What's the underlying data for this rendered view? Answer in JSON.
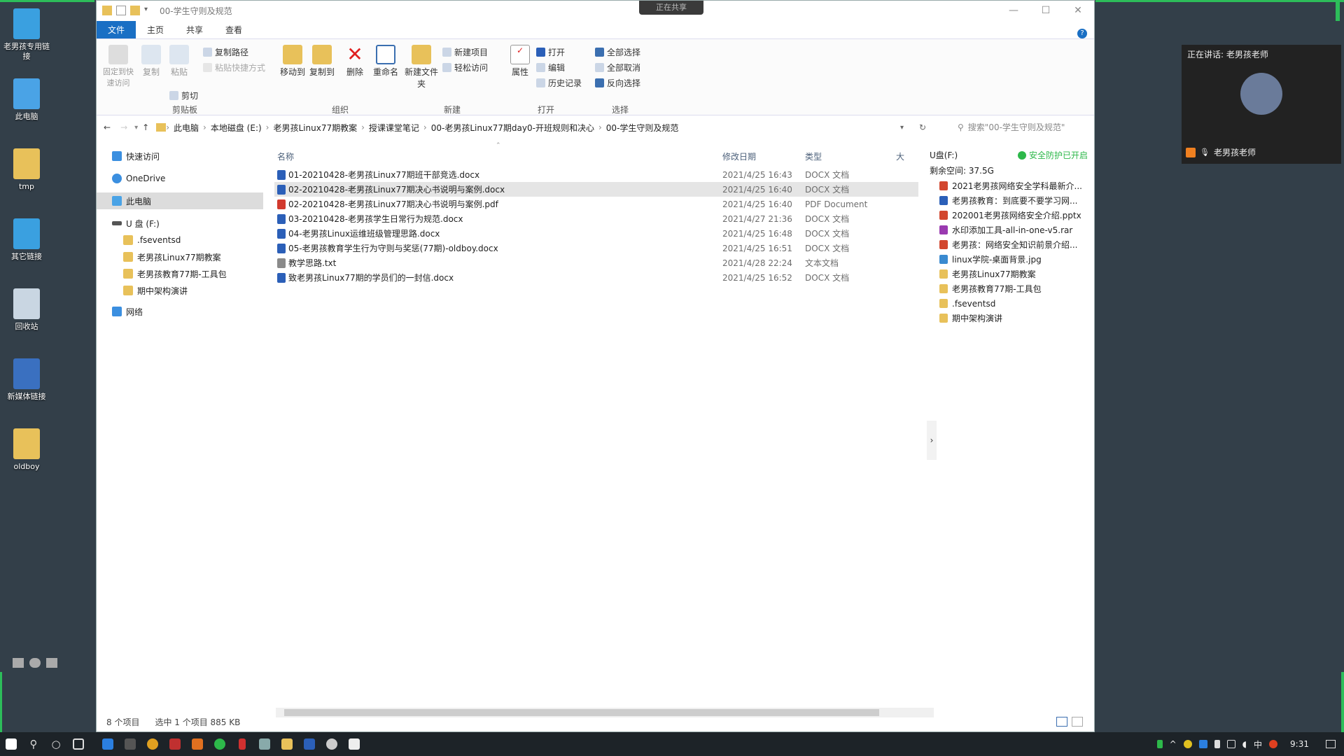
{
  "desktop": {
    "icons": [
      {
        "label": "老男孩专用链接",
        "color": "#3aa0e0"
      },
      {
        "label": "此电脑",
        "color": "#4aa3e6"
      },
      {
        "label": "tmp",
        "color": "#e8c15a"
      },
      {
        "label": "其它链接",
        "color": "#3aa0e0"
      },
      {
        "label": "回收站",
        "color": "#c9d6e2"
      },
      {
        "label": "新媒体链接",
        "color": "#3a70c0"
      },
      {
        "label": "oldboy",
        "color": "#e8c15a"
      }
    ]
  },
  "window": {
    "title": "00-学生守则及规范",
    "share_banner": "正在共享",
    "ribbon_tabs": [
      "文件",
      "主页",
      "共享",
      "查看"
    ],
    "ribbon": {
      "pin": "固定到快速访问",
      "copy": "复制",
      "paste": "粘贴",
      "copy_path": "复制路径",
      "paste_shortcut": "粘贴快捷方式",
      "cut": "剪切",
      "move_to": "移动到",
      "copy_to": "复制到",
      "delete": "删除",
      "rename": "重命名",
      "new_folder": "新建文件夹",
      "new_item": "新建项目",
      "easy_access": "轻松访问",
      "properties": "属性",
      "open": "打开",
      "edit": "编辑",
      "history": "历史记录",
      "select_all": "全部选择",
      "select_none": "全部取消",
      "invert": "反向选择",
      "groups": [
        "剪贴板",
        "组织",
        "新建",
        "打开",
        "选择"
      ]
    },
    "address": {
      "crumbs": [
        "此电脑",
        "本地磁盘 (E:)",
        "老男孩Linux77期教案",
        "授课课堂笔记",
        "00-老男孩Linux77期day0-开班规则和决心",
        "00-学生守则及规范"
      ],
      "search_placeholder": "搜索\"00-学生守则及规范\""
    },
    "nav": {
      "quick_access": "快速访问",
      "onedrive": "OneDrive",
      "this_pc": "此电脑",
      "usb": "U 盘 (F:)",
      "usb_children": [
        ".fseventsd",
        "老男孩Linux77期教案",
        "老男孩教育77期-工具包",
        "期中架构演讲"
      ],
      "network": "网络"
    },
    "columns": {
      "name": "名称",
      "date": "修改日期",
      "type": "类型",
      "size": "大"
    },
    "files": [
      {
        "name": "01-20210428-老男孩Linux77期班干部竞选.docx",
        "date": "2021/4/25 16:43",
        "type": "DOCX 文档",
        "color": "#2b5fb8"
      },
      {
        "name": "02-20210428-老男孩Linux77期决心书说明与案例.docx",
        "date": "2021/4/25 16:40",
        "type": "DOCX 文档",
        "color": "#2b5fb8"
      },
      {
        "name": "02-20210428-老男孩Linux77期决心书说明与案例.pdf",
        "date": "2021/4/25 16:40",
        "type": "PDF Document",
        "color": "#d23a2e"
      },
      {
        "name": "03-20210428-老男孩学生日常行为规范.docx",
        "date": "2021/4/27 21:36",
        "type": "DOCX 文档",
        "color": "#2b5fb8"
      },
      {
        "name": "04-老男孩Linux运维班级管理思路.docx",
        "date": "2021/4/25 16:48",
        "type": "DOCX 文档",
        "color": "#2b5fb8"
      },
      {
        "name": "05-老男孩教育学生行为守则与奖惩(77期)-oldboy.docx",
        "date": "2021/4/25 16:51",
        "type": "DOCX 文档",
        "color": "#2b5fb8"
      },
      {
        "name": "教学思路.txt",
        "date": "2021/4/28 22:24",
        "type": "文本文档",
        "color": "#8a8a8a"
      },
      {
        "name": "致老男孩Linux77期的学员们的一封信.docx",
        "date": "2021/4/25 16:52",
        "type": "DOCX 文档",
        "color": "#2b5fb8"
      }
    ],
    "usb_panel": {
      "title": "U盘(F:)",
      "protect": "安全防护已开启",
      "free": "剩余空间: 37.5G",
      "items": [
        {
          "name": "2021老男孩网络安全学科最新介...",
          "color": "#d2462e"
        },
        {
          "name": "老男孩教育：到底要不要学习网...",
          "color": "#2b5fb8"
        },
        {
          "name": "202001老男孩网络安全介绍.pptx",
          "color": "#d2462e"
        },
        {
          "name": "水印添加工具-all-in-one-v5.rar",
          "color": "#9a3ab0"
        },
        {
          "name": "老男孩：网络安全知识前景介绍...",
          "color": "#d2462e"
        },
        {
          "name": "linux学院-桌面背景.jpg",
          "color": "#3a8ad0"
        },
        {
          "name": "老男孩Linux77期教案",
          "color": "#e8c15a"
        },
        {
          "name": "老男孩教育77期-工具包",
          "color": "#e8c15a"
        },
        {
          "name": ".fseventsd",
          "color": "#e8c15a"
        },
        {
          "name": "期中架构演讲",
          "color": "#e8c15a"
        }
      ]
    },
    "status": {
      "count": "8 个项目",
      "selected": "选中 1 个项目  885 KB"
    }
  },
  "speaker": {
    "speaking": "正在讲话: 老男孩老师",
    "name": "老男孩老师"
  },
  "taskbar": {
    "time": "9:31",
    "ime": "中"
  }
}
